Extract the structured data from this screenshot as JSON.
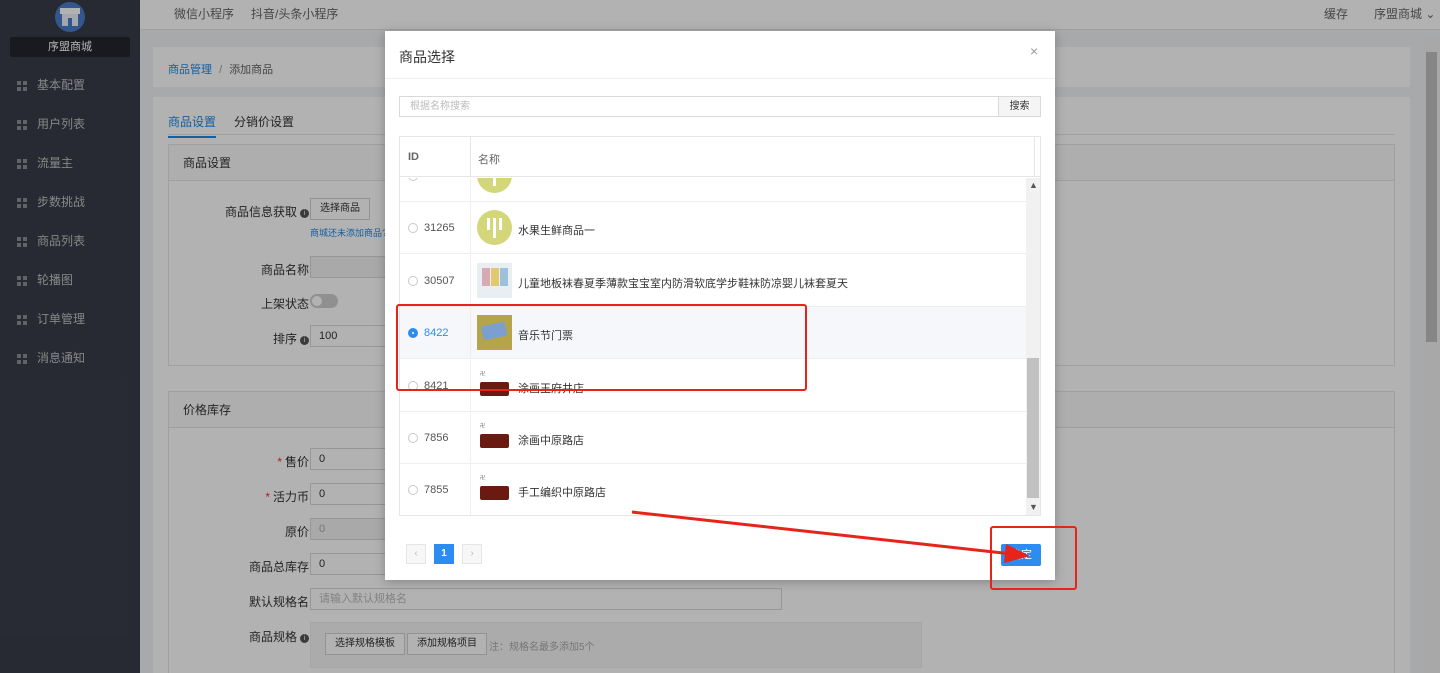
{
  "sidebar": {
    "brand": "序盟商城",
    "items": [
      {
        "label": "基本配置"
      },
      {
        "label": "用户列表"
      },
      {
        "label": "流量主"
      },
      {
        "label": "步数挑战"
      },
      {
        "label": "商品列表"
      },
      {
        "label": "轮播图"
      },
      {
        "label": "订单管理"
      },
      {
        "label": "消息通知"
      }
    ]
  },
  "topbar": {
    "tabs": [
      "微信小程序",
      "抖音/头条小程序"
    ],
    "cache": "缓存",
    "account": "序盟商城"
  },
  "breadcrumb": {
    "parent": "商品管理",
    "separator": "/",
    "current": "添加商品"
  },
  "page_tabs": [
    "商品设置",
    "分销价设置"
  ],
  "goods_panel": {
    "title": "商品设置",
    "info_label": "商品信息获取",
    "select_goods_btn": "选择商品",
    "no_goods_hint": "商城还未添加商品?",
    "name_label": "商品名称",
    "status_label": "上架状态",
    "sort_label": "排序",
    "sort_value": "100"
  },
  "price_panel": {
    "title": "价格库存",
    "price_label": "售价",
    "price_value": "0",
    "coin_label": "活力币",
    "coin_value": "0",
    "orig_label": "原价",
    "orig_value": "0",
    "stock_label": "商品总库存",
    "stock_value": "0",
    "spec_name_label": "默认规格名",
    "spec_name_placeholder": "请输入默认规格名",
    "spec_label": "商品规格",
    "spec_template_btn": "选择规格模板",
    "spec_add_btn": "添加规格项目",
    "spec_note": "注：规格名最多添加5个"
  },
  "modal": {
    "title": "商品选择",
    "close": "×",
    "search_placeholder": "根据名称搜索",
    "search_btn": "搜索",
    "col_id": "ID",
    "col_name": "名称",
    "rows": [
      {
        "id": "",
        "name": "",
        "selected": false,
        "thumb": "wheat"
      },
      {
        "id": "31265",
        "name": "水果生鲜商品一",
        "selected": false,
        "thumb": "wheat"
      },
      {
        "id": "30507",
        "name": "儿童地板袜春夏季薄款宝宝室内防滑软底学步鞋袜防凉婴儿袜套夏天",
        "selected": false,
        "thumb": "socks"
      },
      {
        "id": "8422",
        "name": "音乐节门票",
        "selected": true,
        "thumb": "ticket"
      },
      {
        "id": "8421",
        "name": "涂画王府井店",
        "selected": false,
        "thumb": "box"
      },
      {
        "id": "7856",
        "name": "涂画中原路店",
        "selected": false,
        "thumb": "box"
      },
      {
        "id": "7855",
        "name": "手工编织中原路店",
        "selected": false,
        "thumb": "box"
      }
    ],
    "pager": {
      "prev": "‹",
      "current": "1",
      "next": "›"
    },
    "confirm_btn": "确定"
  },
  "colors": {
    "sidebar_bg": "#393d49",
    "accent": "#2d8cf0",
    "annotation_red": "#e8231a"
  }
}
